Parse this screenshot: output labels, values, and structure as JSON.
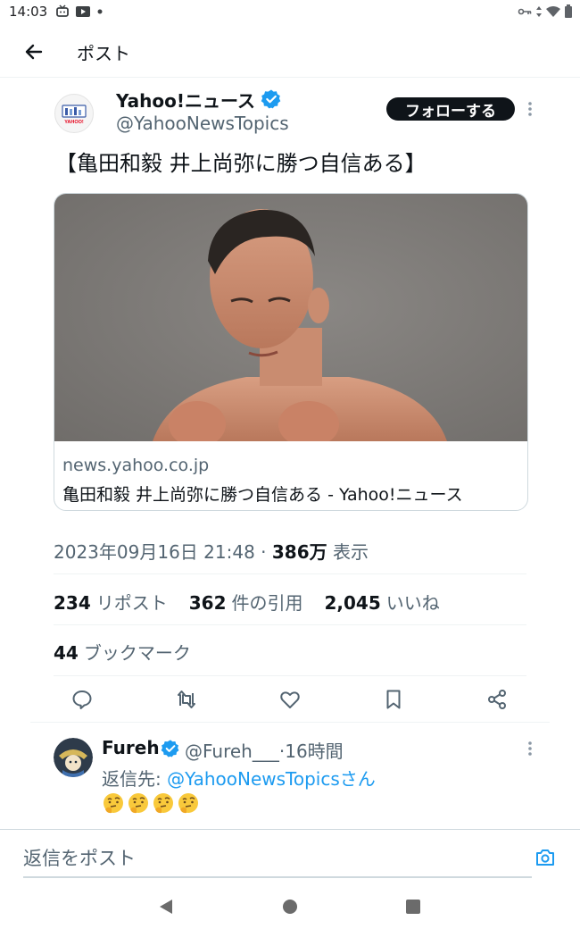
{
  "status_bar": {
    "time": "14:03"
  },
  "header": {
    "title": "ポスト"
  },
  "post": {
    "author_name": "Yahoo!ニュース",
    "author_handle": "@YahooNewsTopics",
    "follow_label": "フォローする",
    "avatar_text": "YAHOO!",
    "text": "【亀田和毅 井上尚弥に勝つ自信ある】",
    "card": {
      "domain": "news.yahoo.co.jp",
      "title": "亀田和毅 井上尚弥に勝つ自信ある - Yahoo!ニュース"
    },
    "timestamp": "2023年09月16日 21:48 · ",
    "views_count": "386万",
    "views_label": " 表示",
    "stats": {
      "reposts_count": "234",
      "reposts_label": "リポスト",
      "quotes_count": "362",
      "quotes_label": "件の引用",
      "likes_count": "2,045",
      "likes_label": "いいね",
      "bookmarks_count": "44",
      "bookmarks_label": "ブックマーク"
    }
  },
  "reply": {
    "author_name": "Fureh",
    "author_handle": "@Fureh___",
    "time": "·16時間",
    "reply_prefix": "返信先: ",
    "reply_to": "@YahooNewsTopicsさん",
    "emoji_icons": [
      "thinking-face-icon",
      "thinking-face-icon",
      "thinking-face-icon",
      "thinking-face-icon"
    ]
  },
  "composer": {
    "placeholder": "返信をポスト"
  },
  "colors": {
    "accent": "#1d9bf0",
    "text_primary": "#0f1419",
    "text_secondary": "#536471",
    "follow_button_bg": "#0f1419",
    "divider": "#eff3f4"
  }
}
